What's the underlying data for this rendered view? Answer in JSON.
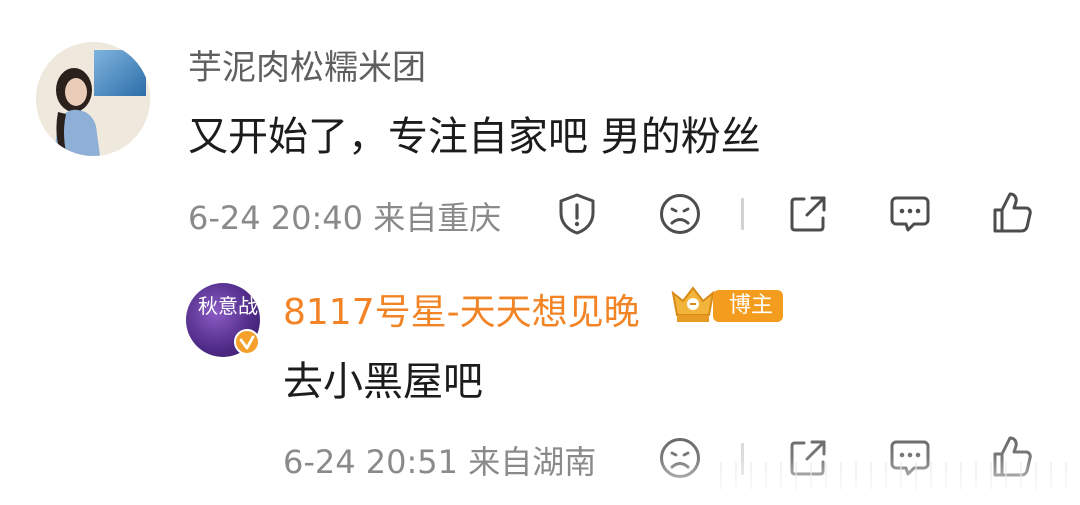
{
  "comments": [
    {
      "username": "芋泥肉松糯米团",
      "text": "又开始了，专注自家吧 男的粉丝",
      "meta": "6-24 20:40  来自重庆",
      "actions": [
        "report-icon",
        "dislike-icon",
        "share-icon",
        "reply-icon",
        "like-icon"
      ]
    },
    {
      "username": "8117号星-天天想见晚",
      "badge": "博主",
      "avatar_text": "秋意战",
      "text": "去小黑屋吧",
      "meta": "6-24 20:51  来自湖南",
      "actions": [
        "dislike-icon",
        "share-icon",
        "reply-icon",
        "like-icon"
      ]
    }
  ],
  "colors": {
    "username_primary": "#5f5f5f",
    "username_host": "#f28425",
    "badge_bg": "#f39c1d",
    "text": "#1c1c1c",
    "meta": "#8a8a8a"
  }
}
